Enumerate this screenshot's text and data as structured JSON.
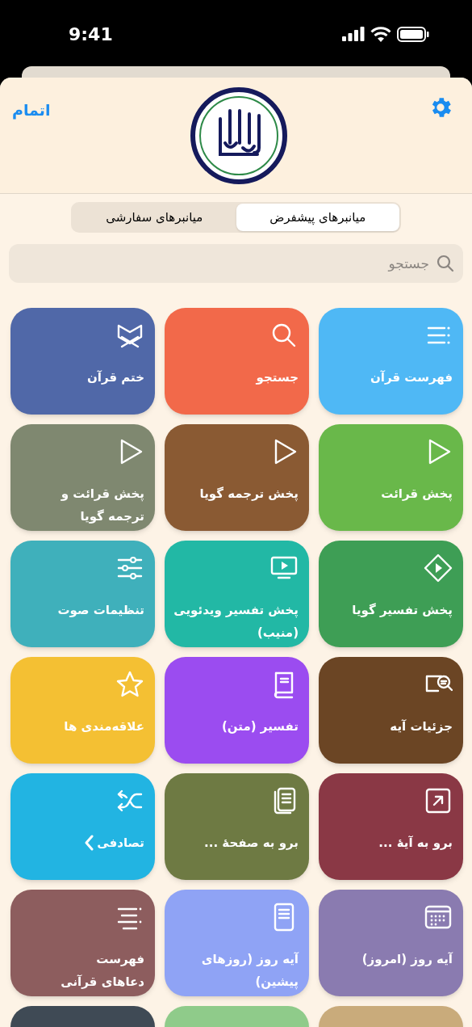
{
  "status_bar": {
    "time": "9:41"
  },
  "header": {
    "done": "اتمام"
  },
  "segments": [
    {
      "label": "میانبرهای پیشفرض",
      "selected": true
    },
    {
      "label": "میانبرهای سفارشی",
      "selected": false
    }
  ],
  "search": {
    "placeholder": "جستجو"
  },
  "tiles": [
    {
      "lines": [
        "فهرست قرآن"
      ],
      "color": "#4fb8f5"
    },
    {
      "lines": [
        "جستجو"
      ],
      "color": "#f2694a"
    },
    {
      "lines": [
        "ختم قرآن"
      ],
      "color": "#5068a8"
    },
    {
      "lines": [
        "پخش قرائت"
      ],
      "color": "#69b84a"
    },
    {
      "lines": [
        "پخش ترجمه گویا"
      ],
      "color": "#8a5a33"
    },
    {
      "lines": [
        "پخش قرائت و",
        "ترجمه گویا"
      ],
      "color": "#7f8870"
    },
    {
      "lines": [
        "پخش تفسیر گویا"
      ],
      "color": "#3e9e55"
    },
    {
      "lines": [
        "پخش تفسیر ویدئویی",
        "(منیب)"
      ],
      "color": "#22b8a5"
    },
    {
      "lines": [
        "تنظیمات صوت"
      ],
      "color": "#3fb0bb"
    },
    {
      "lines": [
        "جزئیات آیه"
      ],
      "color": "#6b4524"
    },
    {
      "lines": [
        "تفسیر (متن)"
      ],
      "color": "#9b4cf0"
    },
    {
      "lines": [
        "علاقه‌مندی ها"
      ],
      "color": "#f4c033"
    },
    {
      "lines": [
        "برو به آیهٔ ..."
      ],
      "color": "#8a3845"
    },
    {
      "lines": [
        "برو به صفحهٔ ..."
      ],
      "color": "#6e7a43"
    },
    {
      "lines": [
        "تصادفی"
      ],
      "color": "#22b4e2",
      "chevron": true
    },
    {
      "lines": [
        "آیه روز (امروز)"
      ],
      "color": "#8a7bb0"
    },
    {
      "lines": [
        "آیه روز (روزهای",
        "پیشین)"
      ],
      "color": "#8fa3f5"
    },
    {
      "lines": [
        "فهرست",
        "دعاهای قرآنی"
      ],
      "color": "#8d5d5e"
    },
    {
      "color": "#c9ab7b"
    },
    {
      "color": "#8fcb8a"
    },
    {
      "color": "#3f4a55"
    }
  ]
}
